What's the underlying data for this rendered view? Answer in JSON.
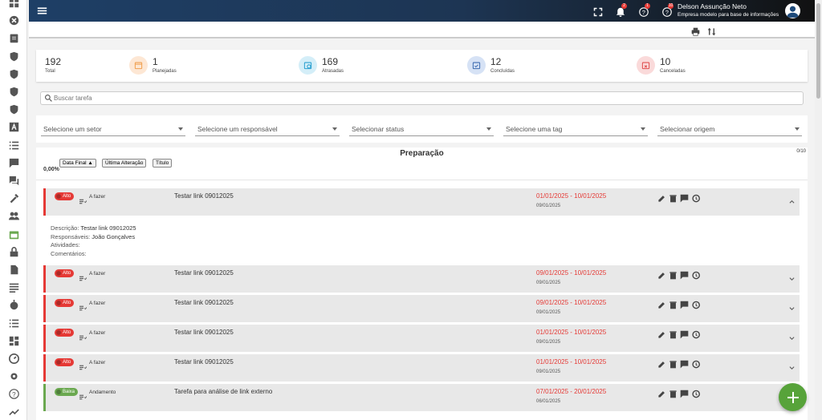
{
  "header": {
    "user_name": "Delson Assunção Neto",
    "company": "Empresa modelo para base de informações",
    "notif_badge": "2",
    "help_badge": "1",
    "updates_badge": "10"
  },
  "stats": [
    {
      "value": "192",
      "label": "Total"
    },
    {
      "value": "1",
      "label": "Planejadas"
    },
    {
      "value": "169",
      "label": "Atrasadas"
    },
    {
      "value": "12",
      "label": "Concluídas"
    },
    {
      "value": "10",
      "label": "Canceladas"
    }
  ],
  "search": {
    "placeholder": "Buscar tarefa"
  },
  "filters": [
    "Selecione um setor",
    "Selecione um responsável",
    "Selecionar status",
    "Selecione uma tag",
    "Selecionar origem"
  ],
  "panel": {
    "title": "Preparação",
    "count": "0/10",
    "percent": "0,00%",
    "sort_buttons": [
      "Data Final ▲",
      "Última Alteração",
      "Título"
    ]
  },
  "tasks": [
    {
      "priority": "Alto",
      "status": "A fazer",
      "title": "Testar link 09012025",
      "dates": "01/01/2025 - 10/01/2025",
      "sub": "09/01/2025"
    },
    {
      "priority": "Alto",
      "status": "A fazer",
      "title": "Testar link 09012025",
      "dates": "09/01/2025 - 10/01/2025",
      "sub": "09/01/2025"
    },
    {
      "priority": "Alto",
      "status": "A fazer",
      "title": "Testar link 09012025",
      "dates": "09/01/2025 - 10/01/2025",
      "sub": "09/01/2025"
    },
    {
      "priority": "Alto",
      "status": "A fazer",
      "title": "Testar link 09012025",
      "dates": "01/01/2025 - 10/01/2025",
      "sub": "09/01/2025"
    },
    {
      "priority": "Alto",
      "status": "A fazer",
      "title": "Testar link 09012025",
      "dates": "01/01/2025 - 10/01/2025",
      "sub": "09/01/2025"
    },
    {
      "priority": "Baixa",
      "status": "Andamento",
      "title": "Tarefa para análise de link externo",
      "dates": "07/01/2025 - 20/01/2025",
      "sub": "06/01/2025"
    }
  ],
  "details": {
    "desc_label": "Descrição:",
    "desc_value": "Testar link 09012025",
    "resp_label": "Responsáveis:",
    "resp_value": "João Gonçalves",
    "atividades": "Atividades:",
    "comentarios": "Comentários:"
  },
  "colors": {
    "high": "#e53935",
    "low": "#6aa84f",
    "accent": "#1e3f66",
    "fab": "#57a33a"
  }
}
